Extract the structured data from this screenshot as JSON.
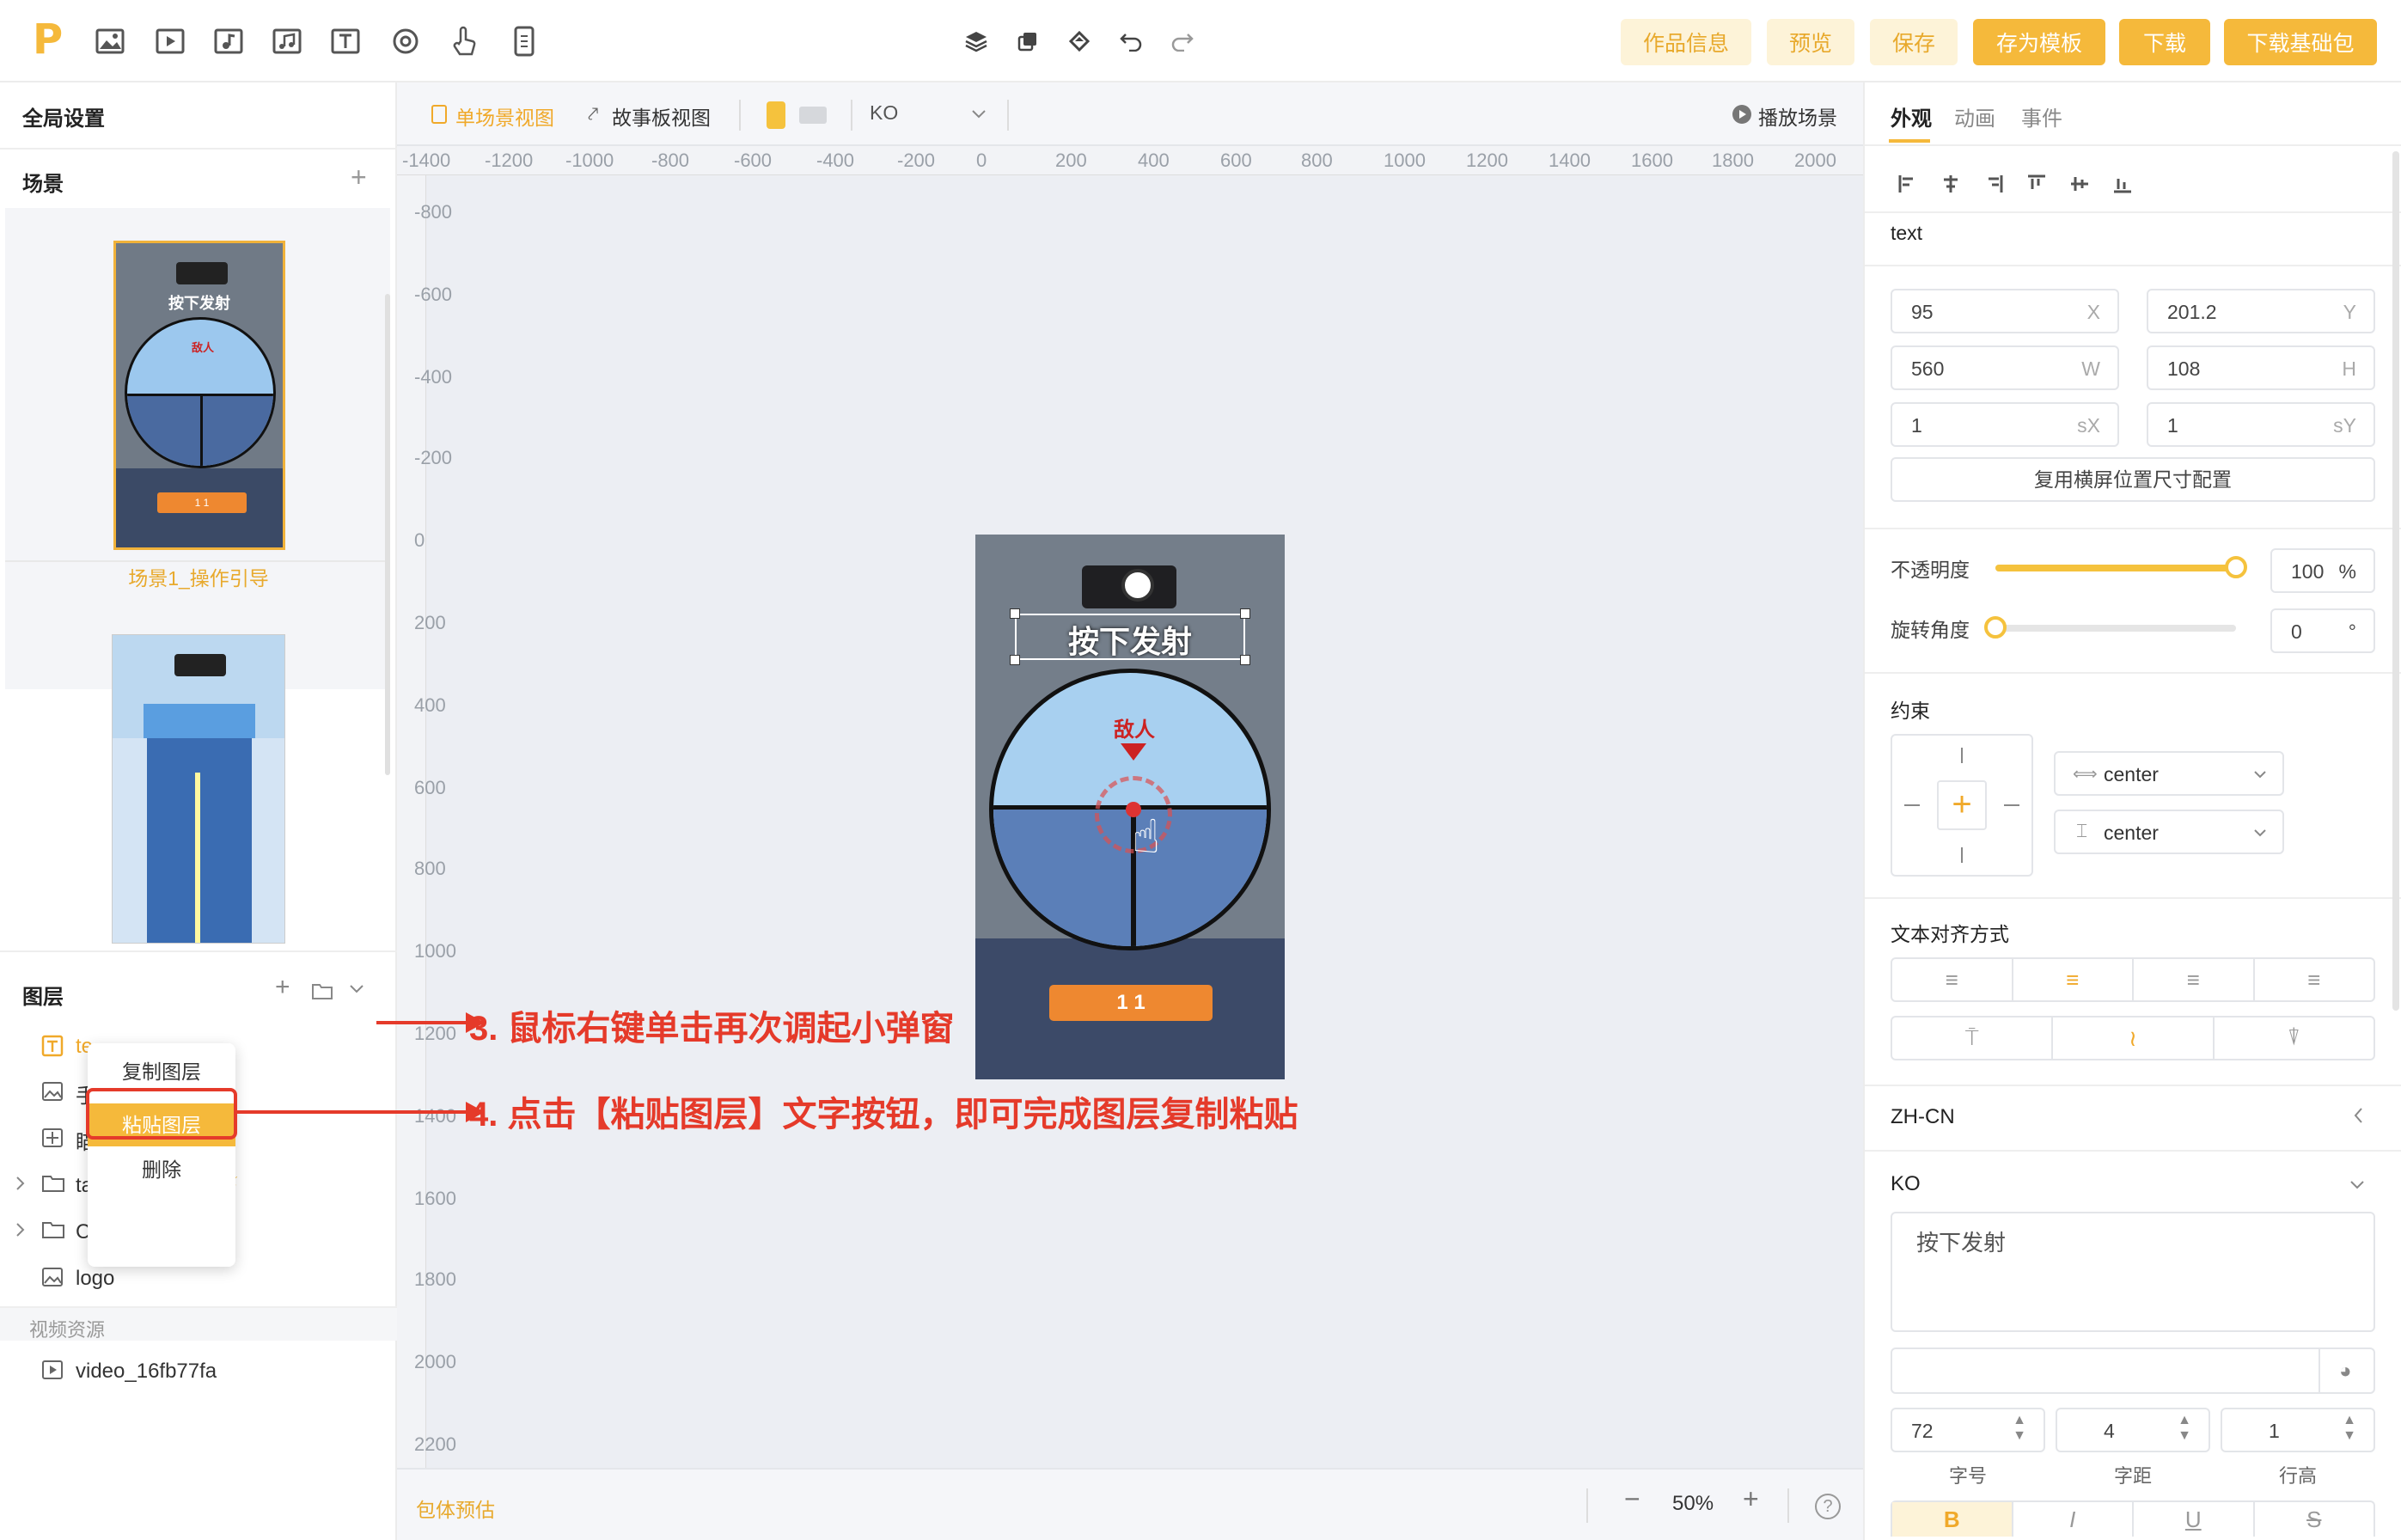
{
  "topbar": {
    "logo": "P",
    "tools": [
      "image-icon",
      "video-icon",
      "audio-icon",
      "music-icon",
      "text-icon",
      "shape-icon",
      "gesture-icon",
      "device-icon"
    ],
    "center_tools": [
      "layers-icon",
      "copy-icon",
      "paint-icon",
      "undo-icon",
      "redo-icon"
    ],
    "buttons": {
      "info": "作品信息",
      "preview": "预览",
      "save": "保存",
      "save_template": "存为模板",
      "download": "下载",
      "download_base": "下载基础包"
    }
  },
  "left": {
    "global_settings": "全局设置",
    "scenes_title": "场景",
    "scene1_label": "场景1_操作引导",
    "layers_title": "图层",
    "layers": [
      "te",
      "手",
      "瞄",
      "target",
      "CTA",
      "logo"
    ],
    "video_section": "视频资源",
    "video_item": "video_16fb77fa",
    "context_menu": {
      "copy": "复制图层",
      "paste": "粘贴图层",
      "delete": "删除"
    }
  },
  "editor": {
    "view_single": "单场景视图",
    "view_story": "故事板视图",
    "lang": "KO",
    "play_scene": "播放场景",
    "ruler_h": [
      "-1400",
      "-1200",
      "-1000",
      "-800",
      "-600",
      "-400",
      "-200",
      "0",
      "200",
      "400",
      "600",
      "800",
      "1000",
      "1200",
      "1400",
      "1600",
      "1800",
      "2000"
    ],
    "ruler_v": [
      "-800",
      "-600",
      "-400",
      "-200",
      "0",
      "200",
      "400",
      "600",
      "800",
      "1000",
      "1200",
      "1400",
      "1600",
      "1800",
      "2000",
      "2200"
    ],
    "ruler_origin": "0",
    "package_estimate": "包体预估",
    "zoom": "50%",
    "canvas": {
      "title_text": "按下发射",
      "enemy_label": "敌人",
      "cta_label": "1 1"
    },
    "thumb": {
      "title_text": "按下发射",
      "enemy_label": "敌人",
      "cta_label": "1 1"
    }
  },
  "annotations": {
    "step3": "3. 鼠标右键单击再次调起小弹窗",
    "step4": "4. 点击【粘贴图层】文字按钮，即可完成图层复制粘贴"
  },
  "right": {
    "tabs": [
      "外观",
      "动画",
      "事件"
    ],
    "element_name": "text",
    "x": "95",
    "x_label": "X",
    "y": "201.2",
    "y_label": "Y",
    "w": "560",
    "w_label": "W",
    "h": "108",
    "h_label": "H",
    "sx": "1",
    "sx_label": "sX",
    "sy": "1",
    "sy_label": "sY",
    "reuse_button": "复用横屏位置尺寸配置",
    "opacity_label": "不透明度",
    "opacity_value": "100",
    "opacity_unit": "%",
    "opacity_level": 1.0,
    "rotation_label": "旋转角度",
    "rotation_value": "0",
    "rotation_unit": "°",
    "rotation_level": 0.0,
    "constraint_title": "约束",
    "constraint_h": "center",
    "constraint_v": "center",
    "text_align_title": "文本对齐方式",
    "lang_zh": "ZH-CN",
    "lang_ko": "KO",
    "text_content": "按下发射",
    "font_size": "72",
    "font_size_label": "字号",
    "letter_spacing": "4",
    "letter_spacing_label": "字距",
    "line_height": "1",
    "line_height_label": "行高",
    "style_buttons": [
      "B",
      "I",
      "U",
      "S"
    ]
  },
  "colors": {
    "accent": "#f5b93b",
    "accent_text": "#e8a92c",
    "annotation": "#e53a2a"
  }
}
